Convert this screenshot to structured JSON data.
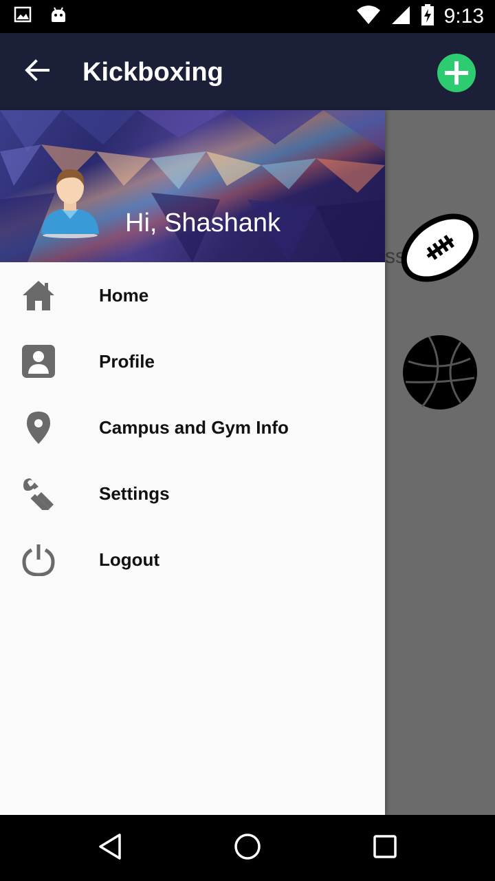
{
  "status_bar": {
    "time": "9:13",
    "icons": [
      "image-icon",
      "android-icon",
      "wifi-icon",
      "signal-icon",
      "battery-charging-icon"
    ]
  },
  "app_bar": {
    "title": "Kickboxing",
    "back_icon": "arrow-left-icon",
    "add_icon": "plus-circle-icon",
    "add_color": "#2ecc71",
    "background": "#1b2038"
  },
  "background_content": {
    "partial_text": "ss",
    "icons": [
      "football-icon",
      "basketball-icon"
    ]
  },
  "drawer": {
    "greeting": "Hi, Shashank",
    "menu": [
      {
        "label": "Home",
        "icon": "home-icon"
      },
      {
        "label": "Profile",
        "icon": "profile-icon"
      },
      {
        "label": "Campus and Gym Info",
        "icon": "location-pin-icon"
      },
      {
        "label": "Settings",
        "icon": "wrench-icon"
      },
      {
        "label": "Logout",
        "icon": "power-icon"
      }
    ]
  },
  "nav_bar": {
    "buttons": [
      "back-triangle-icon",
      "home-circle-icon",
      "recents-square-icon"
    ]
  }
}
